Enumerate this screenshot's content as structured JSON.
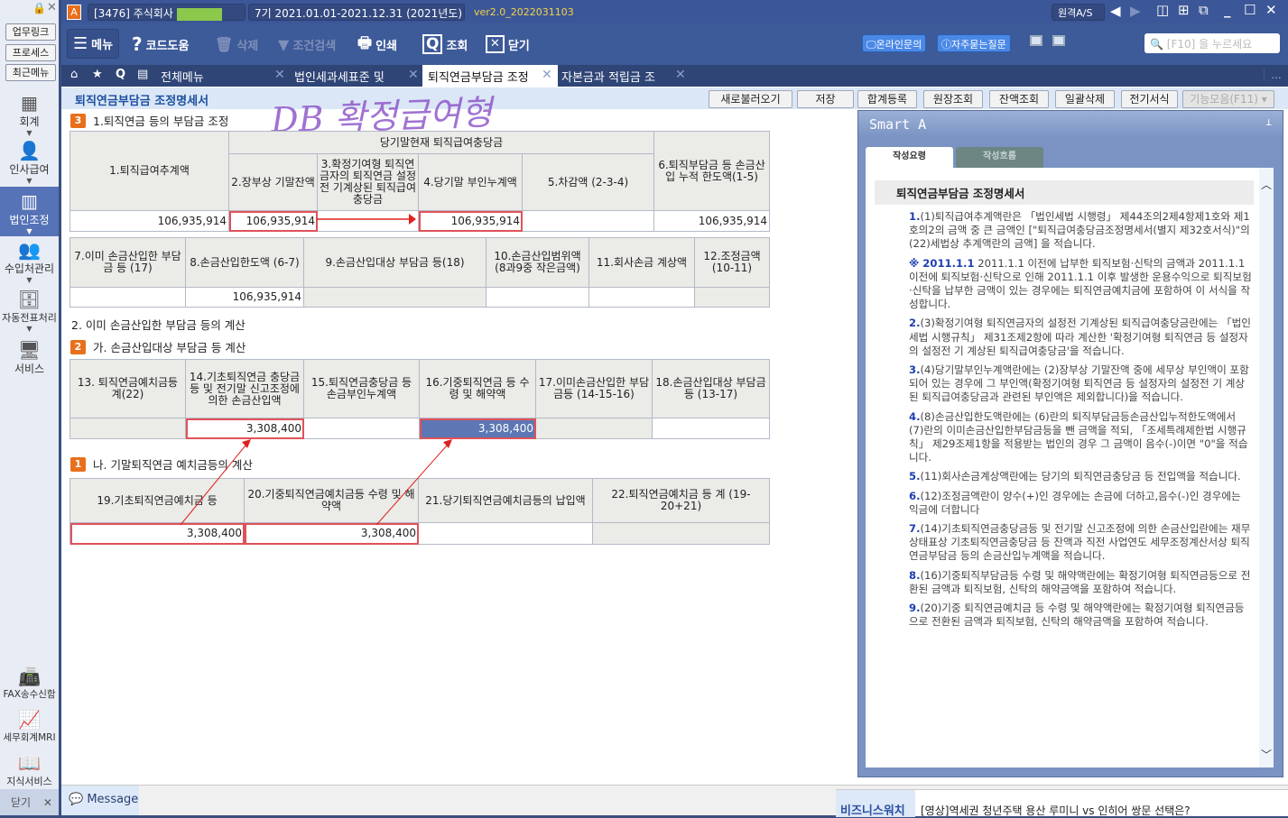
{
  "titlebar": {
    "app_icon": "A",
    "company": "[3476] 주식회사",
    "period": "7기  2021.01.01-2021.12.31",
    "year": "(2021년도)",
    "version": "ver2.0_2022031103",
    "remote": "원격A/S"
  },
  "toolbar": {
    "menu": "메뉴",
    "help": "코드도움",
    "delete": "삭제",
    "filter": "조건검색",
    "print": "인쇄",
    "search": "조회",
    "close": "닫기",
    "online": "온라인문의",
    "faq": "자주묻는질문",
    "search_placeholder": "[F10] 을 누르세요"
  },
  "tabs": {
    "all": "전체메뉴",
    "items": [
      "법인세과세표준 및",
      "퇴직연금부담금 조정",
      "자본금과 적립금 조"
    ],
    "more": "..."
  },
  "sidebar": {
    "buttons": [
      "업무링크",
      "프로세스",
      "최근메뉴"
    ],
    "nav": [
      "회계",
      "인사급여",
      "법인조정",
      "수입처관리",
      "자동전표처리",
      "서비스"
    ],
    "bottom": [
      "FAX송수신함",
      "세무회계MRI",
      "지식서비스"
    ],
    "close": "닫기"
  },
  "page": {
    "title": "퇴직연금부담금 조정명세서",
    "handwriting": "DB 확정급여형",
    "buttons": [
      "새로불러오기",
      "저장",
      "합계등록",
      "원장조회",
      "잔액조회",
      "일괄삭제",
      "전기서식",
      "기능모음(F11)"
    ]
  },
  "sec1": {
    "badge": "3",
    "title": "1.퇴직연금 등의 부담금 조정",
    "t1": {
      "group": "당기말현재 퇴직급여충당금",
      "h": [
        "1.퇴직급여추계액",
        "2.장부상 기말잔액",
        "3.확정기여형 퇴직연금자의 퇴직연금 설정전 기계상된 퇴직급여 충당금",
        "4.당기말 부인누계액",
        "5.차감액 (2-3-4)",
        "6.퇴직부담금 등 손금산입 누적 한도액(1-5)"
      ],
      "v": [
        "106,935,914",
        "106,935,914",
        "",
        "106,935,914",
        "",
        "106,935,914"
      ]
    },
    "t2": {
      "h": [
        "7.이미 손금산입한 부담금 등 (17)",
        "8.손금산입한도액 (6-7)",
        "9.손금산입대상 부담금 등(18)",
        "10.손금산입범위액 (8과9중 작은금액)",
        "11.회사손금 계상액",
        "12.조정금액 (10-11)"
      ],
      "v": [
        "",
        "106,935,914",
        "",
        "",
        "",
        ""
      ]
    }
  },
  "sec2": {
    "title": "2. 이미 손금산입한 부담금 등의 계산",
    "sub_badge": "2",
    "sub_title": "가. 손금산입대상 부담금 등 계산",
    "t3": {
      "h": [
        "13. 퇴직연금예치금등 계(22)",
        "14.기초퇴직연금 충당금등 및 전기말 신고조정에의한 손금산입액",
        "15.퇴직연금충당금 등 손금부인누계액",
        "16.기중퇴직연금 등 수령 및 해약액",
        "17.이미손금산입한 부담금등 (14-15-16)",
        "18.손금산입대상 부담금등 (13-17)"
      ],
      "v": [
        "",
        "3,308,400",
        "",
        "3,308,400",
        "",
        ""
      ]
    }
  },
  "sec3": {
    "badge": "1",
    "title": "나. 기말퇴직연금 예치금등의 계산",
    "t4": {
      "h": [
        "19.기초퇴직연금예치금 등",
        "20.기중퇴직연금예치금등 수령 및 해약액",
        "21.당기퇴직연금예치금등의 납입액",
        "22.퇴직연금예치금 등 계 (19-20+21)"
      ],
      "v": [
        "3,308,400",
        "3,308,400",
        "",
        ""
      ]
    }
  },
  "smart": {
    "title": "Smart A",
    "tabs": [
      "작성요령",
      "작성흐름"
    ],
    "doc_title": "퇴직연금부담금 조정명세서",
    "items": [
      {
        "n": "1.",
        "t": "(1)퇴직급여추계액란은 「법인세법 시행령」 제44조의2제4항제1호와 제1호의2의 금액 중 큰 금액인 [\"퇴직급여충당금조정명세서(별지 제32호서식)\"의 (22)세법상 추계액란의 금액] 을 적습니다."
      },
      {
        "n": "※ 2011.1.1",
        "t": " 2011.1.1 이전에 납부한 퇴직보험·신탁의 금액과 2011.1.1 이전에 퇴직보험·신탁으로 인해 2011.1.1 이후 발생한 운용수익으로 퇴직보험·신탁을 납부한 금액이 있는 경우에는 퇴직연금예치금에 포함하여 이 서식을 작성합니다."
      },
      {
        "n": "2.",
        "t": "(3)확정기여형 퇴직연금자의 설정전 기계상된 퇴직급여충당금란에는 「법인세법 시행규칙」 제31조제2항에 따라 계산한 '확정기여형 퇴직연금 등 설정자의 설정전 기 계상된 퇴직급여충당금'을 적습니다."
      },
      {
        "n": "3.",
        "t": "(4)당기말부인누계액란에는 (2)장부상 기말잔액 중에 세무상 부인액이 포함되어 있는 경우에 그 부인액(확정기여형 퇴직연금 등 설정자의 설정전 기 계상된 퇴직급여충당금과 관련된 부인액은 제외합니다)을 적습니다."
      },
      {
        "n": "4.",
        "t": "(8)손금산입한도액란에는 (6)란의 퇴직부담금등손금산입누적한도액에서 (7)란의 이미손금산입한부담금등을 뺀 금액을 적되, 「조세특례제한법 시행규칙」 제29조제1항을 적용받는 법인의 경우 그 금액이 음수(-)이면 \"0\"을 적습니다."
      },
      {
        "n": "5.",
        "t": "(11)회사손금계상액란에는 당기의 퇴직연금충당금 등 전입액을 적습니다."
      },
      {
        "n": "6.",
        "t": "(12)조정금액란이 양수(+)인 경우에는 손금에 더하고,음수(-)인 경우에는 익금에 더합니다"
      },
      {
        "n": "7.",
        "t": "(14)기초퇴직연금충당금등 및 전기말 신고조정에 의한 손금산입란에는 재무상태표상 기초퇴직연금충당금 등 잔액과 직전 사업연도 세무조정계산서상 퇴직연금부담금 등의 손금산입누계액을 적습니다."
      },
      {
        "n": "8.",
        "t": "(16)기중퇴직부담금등 수령 및 해약액란에는 확정기여형 퇴직연금등으로 전환된 금액과 퇴직보험, 신탁의 해약금액을 포함하여 적습니다."
      },
      {
        "n": "9.",
        "t": "(20)기중 퇴직연금예치금 등 수령 및 해약액란에는 확정기여형 퇴직연금등으로 전환된 금액과 퇴직보험, 신탁의 해약금액을 포함하여 적습니다."
      }
    ]
  },
  "bottom": {
    "message": "Message",
    "news_label": "비즈니스워치",
    "news": "[영상]역세권 청년주택 용산 루미니 vs 인히어 쌍문 선택은?"
  }
}
